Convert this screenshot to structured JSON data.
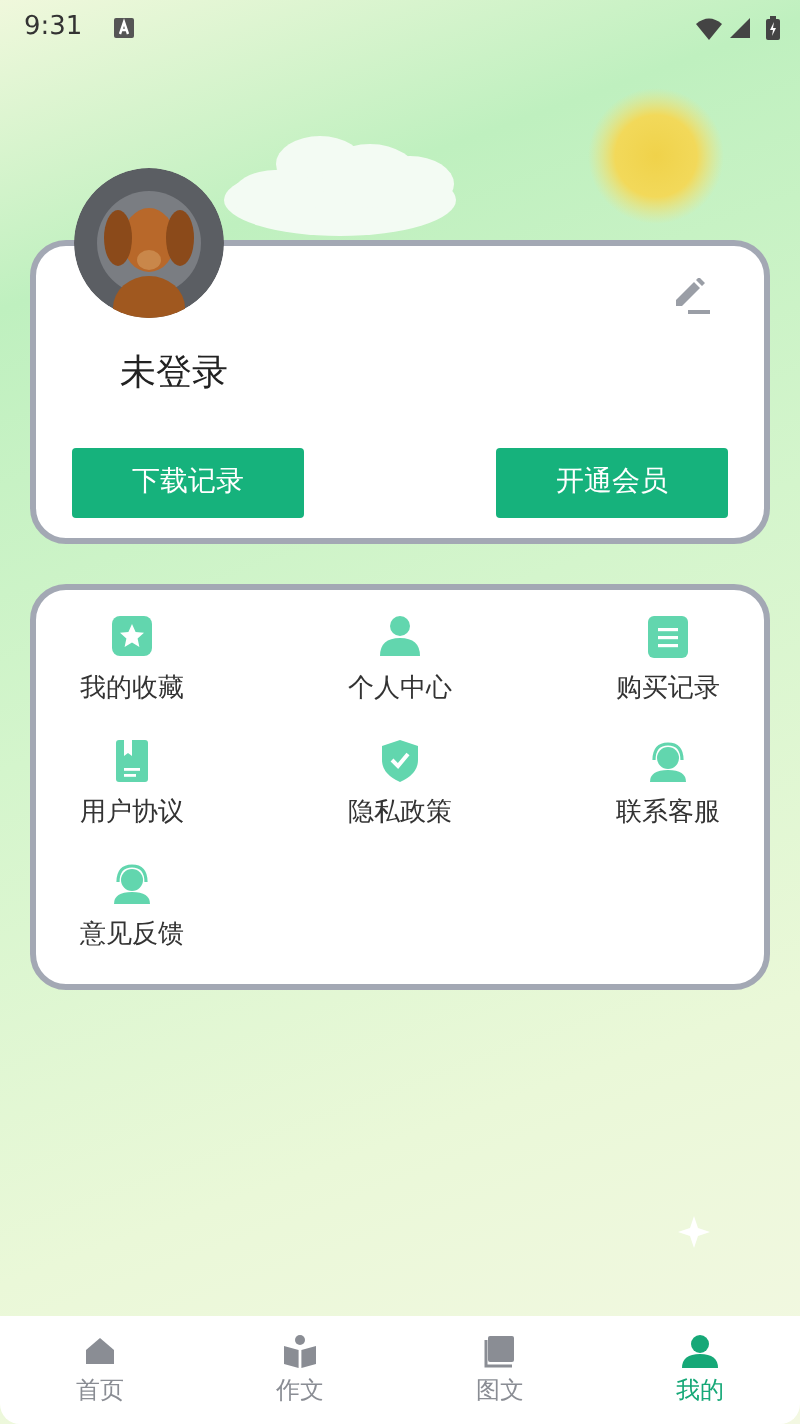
{
  "status_bar": {
    "time": "9:31"
  },
  "profile": {
    "name": "未登录",
    "buttons": [
      "下载记录",
      "开通会员"
    ]
  },
  "menu": [
    {
      "label": "我的收藏"
    },
    {
      "label": "个人中心"
    },
    {
      "label": "购买记录"
    },
    {
      "label": "用户协议"
    },
    {
      "label": "隐私政策"
    },
    {
      "label": "联系客服"
    },
    {
      "label": "意见反馈"
    }
  ],
  "tabs": [
    {
      "label": "首页",
      "selected": false
    },
    {
      "label": "作文",
      "selected": false
    },
    {
      "label": "图文",
      "selected": false
    },
    {
      "label": "我的",
      "selected": true
    }
  ]
}
